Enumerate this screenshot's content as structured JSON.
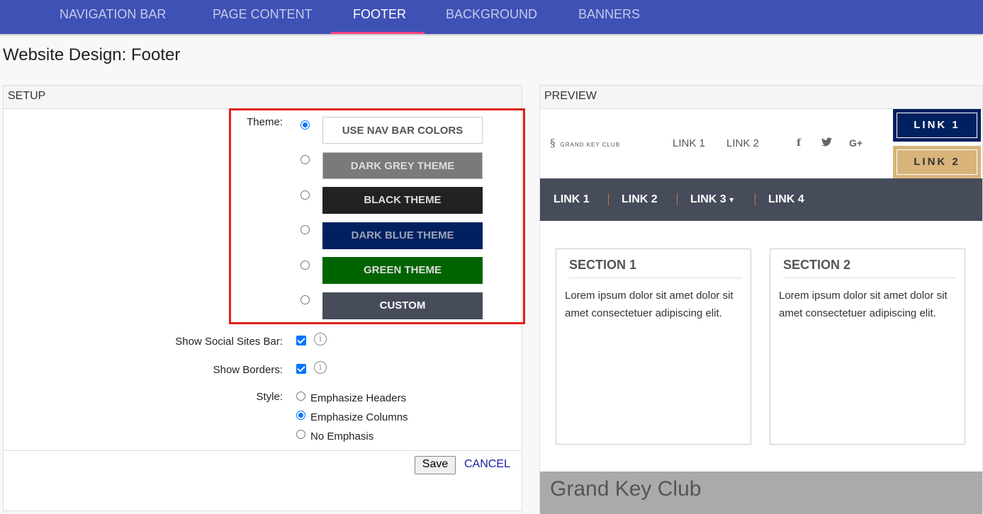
{
  "tabs": [
    {
      "label": "NAVIGATION BAR"
    },
    {
      "label": "PAGE CONTENT"
    },
    {
      "label": "FOOTER"
    },
    {
      "label": "BACKGROUND"
    },
    {
      "label": "BANNERS"
    }
  ],
  "active_tab": "FOOTER",
  "page_title": "Website Design: Footer",
  "setup": {
    "header": "SETUP",
    "theme_label": "Theme:",
    "themes": [
      {
        "label": "USE NAV BAR COLORS",
        "bg": "#ffffff",
        "fg": "#555555",
        "selected": true
      },
      {
        "label": "DARK GREY THEME",
        "bg": "#7a7a7a",
        "fg": "#dddddd",
        "selected": false
      },
      {
        "label": "BLACK THEME",
        "bg": "#222222",
        "fg": "#dddddd",
        "selected": false
      },
      {
        "label": "DARK BLUE THEME",
        "bg": "#002060",
        "fg": "#9aa2b8",
        "selected": false
      },
      {
        "label": "GREEN THEME",
        "bg": "#006400",
        "fg": "#dddddd",
        "selected": false
      },
      {
        "label": "CUSTOM",
        "bg": "#464c5a",
        "fg": "#ffffff",
        "selected": false
      }
    ],
    "social_label": "Show Social Sites Bar:",
    "social_checked": true,
    "borders_label": "Show Borders:",
    "borders_checked": true,
    "info_icon": "i",
    "style_label": "Style:",
    "style_options": [
      {
        "label": "Emphasize Headers",
        "selected": false
      },
      {
        "label": "Emphasize Columns",
        "selected": true
      },
      {
        "label": "No Emphasis",
        "selected": false
      }
    ],
    "save_label": "Save",
    "cancel_label": "CANCEL"
  },
  "preview": {
    "header": "PREVIEW",
    "logo_text": "GRAND KEY CLUB",
    "top_links": [
      "LINK 1",
      "LINK 2"
    ],
    "social_icons": [
      {
        "name": "facebook-icon",
        "glyph": "f"
      },
      {
        "name": "twitter-icon",
        "glyph": "t"
      },
      {
        "name": "google-plus-icon",
        "glyph": "G+"
      }
    ],
    "buttons": [
      {
        "label": "LINK 1",
        "bg": "#002060",
        "fg": "#ffffff",
        "border": "#ffffff"
      },
      {
        "label": "LINK 2",
        "bg": "#d8b47a",
        "fg": "#333333",
        "border": "#ffffff"
      }
    ],
    "nav_links": [
      "LINK 1",
      "LINK 2",
      "LINK 3",
      "LINK 4"
    ],
    "nav_dropdown_icon": "▾",
    "sections": [
      {
        "title": "SECTION 1",
        "body": "Lorem ipsum dolor sit amet dolor sit amet consectetuer adipiscing elit."
      },
      {
        "title": "SECTION 2",
        "body": "Lorem ipsum dolor sit amet dolor sit amet consectetuer adipiscing elit."
      }
    ],
    "footer_text": "Grand Key Club"
  },
  "colors": {
    "topnav_bg": "#3f51b5",
    "tab_underline": "#ff4081",
    "highlight_box": "#e0201c",
    "accent": "#0075ff"
  }
}
